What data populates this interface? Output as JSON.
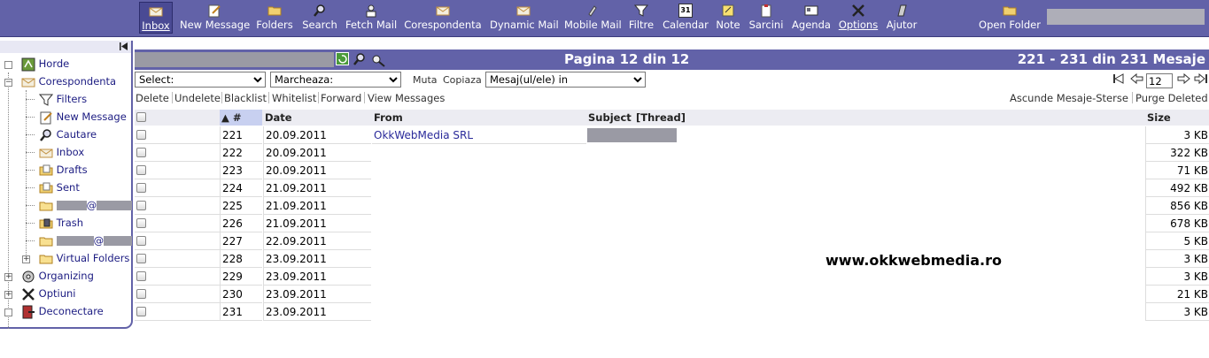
{
  "menu": {
    "items": [
      {
        "label": "Inbox",
        "icon": "inbox-icon"
      },
      {
        "label": "New Message",
        "icon": "compose-icon"
      },
      {
        "label": "Folders",
        "icon": "folder-icon"
      },
      {
        "label": "Search",
        "icon": "search-icon"
      },
      {
        "label": "Fetch Mail",
        "icon": "fetch-mail-icon"
      },
      {
        "label": "Corespondenta",
        "icon": "mail-icon"
      },
      {
        "label": "Dynamic Mail",
        "icon": "mail-icon"
      },
      {
        "label": "Mobile Mail",
        "icon": "mobile-icon"
      },
      {
        "label": "Filtre",
        "icon": "filter-icon"
      },
      {
        "label": "Calendar",
        "icon": "calendar-icon"
      },
      {
        "label": "Note",
        "icon": "note-icon"
      },
      {
        "label": "Sarcini",
        "icon": "tasks-icon"
      },
      {
        "label": "Agenda",
        "icon": "addressbook-icon"
      },
      {
        "label": "Options",
        "icon": "options-icon"
      },
      {
        "label": "Ajutor",
        "icon": "help-icon"
      },
      {
        "label": "Open Folder",
        "icon": "open-folder-icon"
      }
    ],
    "calendar_day": "31"
  },
  "sidebar": {
    "items": [
      {
        "label": "Horde"
      },
      {
        "label": "Corespondenta"
      },
      {
        "label": "Filters"
      },
      {
        "label": "New Message"
      },
      {
        "label": "Cautare"
      },
      {
        "label": "Inbox"
      },
      {
        "label": "Drafts"
      },
      {
        "label": "Sent"
      },
      {
        "label": "@"
      },
      {
        "label": "Trash"
      },
      {
        "label": "@"
      },
      {
        "label": "Virtual Folders"
      },
      {
        "label": "Organizing"
      },
      {
        "label": "Optiuni"
      },
      {
        "label": "Deconectare"
      }
    ]
  },
  "header": {
    "page_title": "Pagina 12 din 12",
    "count_title": "221 - 231 din 231 Mesaje"
  },
  "controls": {
    "select_placeholder": "Select:",
    "mark_placeholder": "Marcheaza:",
    "move_label": "Muta",
    "copy_label": "Copiaza",
    "target_placeholder": "Mesaj(ul/ele) in",
    "page_input": "12"
  },
  "toolbar": {
    "left": [
      "Delete",
      "Undelete",
      "Blacklist",
      "Whitelist",
      "Forward",
      "View Messages"
    ],
    "right": [
      "Ascunde Mesaje-Sterse",
      "Purge Deleted"
    ]
  },
  "table": {
    "headers": {
      "num": "▲ #",
      "date": "Date",
      "from": "From",
      "subject": "Subject",
      "thread": "[Thread]",
      "size": "Size"
    },
    "rows": [
      {
        "num": "221",
        "date": "20.09.2011",
        "from": "OkkWebMedia SRL",
        "size": "3 KB"
      },
      {
        "num": "222",
        "date": "20.09.2011",
        "from": "",
        "size": "322 KB"
      },
      {
        "num": "223",
        "date": "20.09.2011",
        "from": "",
        "size": "71 KB"
      },
      {
        "num": "224",
        "date": "21.09.2011",
        "from": "",
        "size": "492 KB"
      },
      {
        "num": "225",
        "date": "21.09.2011",
        "from": "",
        "size": "856 KB"
      },
      {
        "num": "226",
        "date": "21.09.2011",
        "from": "",
        "size": "678 KB"
      },
      {
        "num": "227",
        "date": "22.09.2011",
        "from": "",
        "size": "5 KB"
      },
      {
        "num": "228",
        "date": "23.09.2011",
        "from": "",
        "size": "3 KB"
      },
      {
        "num": "229",
        "date": "23.09.2011",
        "from": "",
        "size": "3 KB"
      },
      {
        "num": "230",
        "date": "23.09.2011",
        "from": "",
        "size": "21 KB"
      },
      {
        "num": "231",
        "date": "23.09.2011",
        "from": "",
        "size": "3 KB"
      }
    ]
  },
  "watermark": "www.okkwebmedia.ro",
  "colors": {
    "menu_bg": "#6262a8",
    "header_bg": "#6262a8",
    "link": "#2a2a9a"
  }
}
